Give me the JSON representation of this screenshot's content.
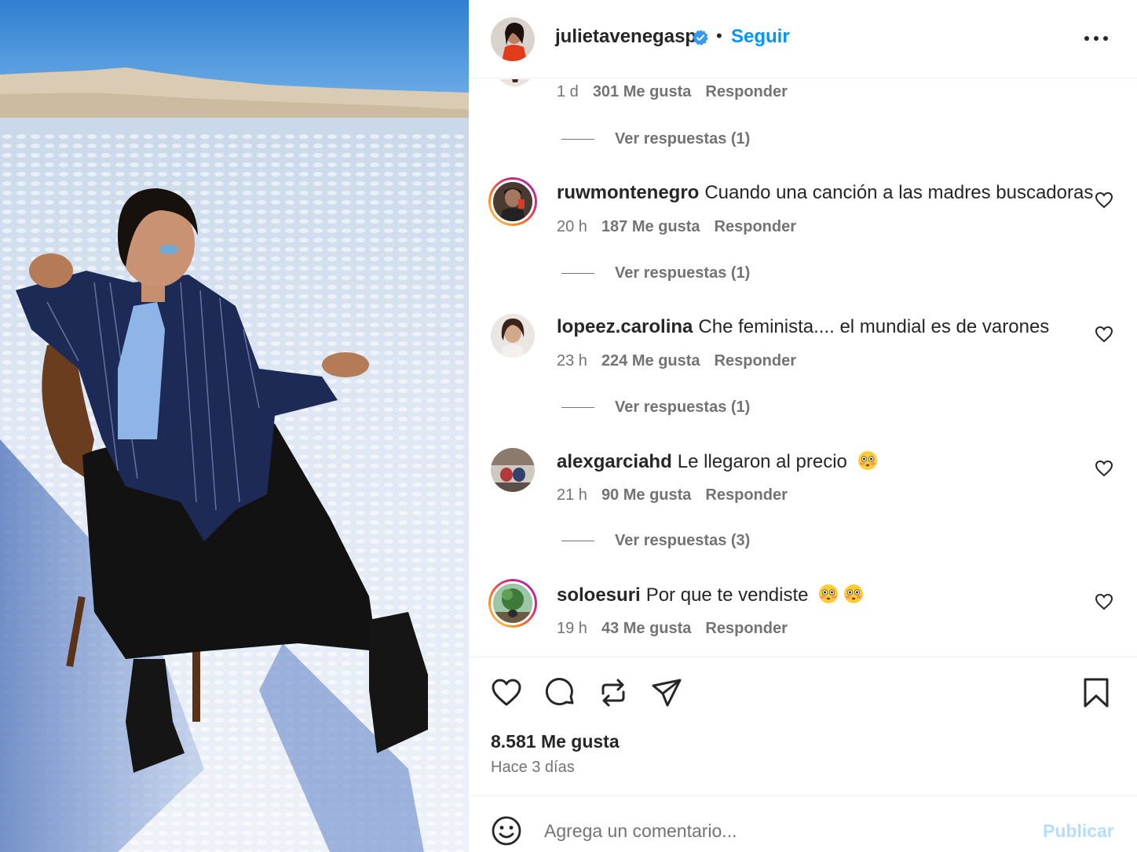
{
  "post_author": {
    "username": "julietavenegasp",
    "verified": true,
    "separator": "•",
    "follow_label": "Seguir"
  },
  "previous_comment": {
    "time": "1 d",
    "likes": "301 Me gusta",
    "reply_label": "Responder",
    "view_replies": "Ver respuestas (1)"
  },
  "comments": [
    {
      "user": "ruwmontenegro",
      "text": "Cuando una canción a las madres buscadoras",
      "time": "20 h",
      "likes": "187 Me gusta",
      "reply_label": "Responder",
      "view_replies": "Ver respuestas (1)",
      "story_ring": true
    },
    {
      "user": "lopeez.carolina",
      "text": "Che feminista.... el mundial es de varones",
      "time": "23 h",
      "likes": "224 Me gusta",
      "reply_label": "Responder",
      "view_replies": "Ver respuestas (1)",
      "story_ring": false
    },
    {
      "user": "alexgarciahd",
      "text": "Le llegaron al precio",
      "emojis": [
        "flushed-face"
      ],
      "time": "21 h",
      "likes": "90 Me gusta",
      "reply_label": "Responder",
      "view_replies": "Ver respuestas (3)",
      "story_ring": false
    },
    {
      "user": "soloesuri",
      "text": "Por que te vendiste",
      "emojis": [
        "flushed-face",
        "flushed-face"
      ],
      "time": "19 h",
      "likes": "43 Me gusta",
      "reply_label": "Responder",
      "story_ring": true
    }
  ],
  "actions": {
    "icons": [
      "heart-icon",
      "comment-icon",
      "repost-icon",
      "share-icon",
      "bookmark-icon"
    ],
    "likes_total": "8.581 Me gusta",
    "posted_ago": "Hace 3 días"
  },
  "composer": {
    "placeholder": "Agrega un comentario...",
    "publish_label": "Publicar"
  },
  "colors": {
    "link_blue": "#0095f6",
    "publish_disabled": "#b2dffc",
    "secondary_text": "#737373",
    "primary_text": "#262626",
    "verified_blue": "#3897f0"
  }
}
